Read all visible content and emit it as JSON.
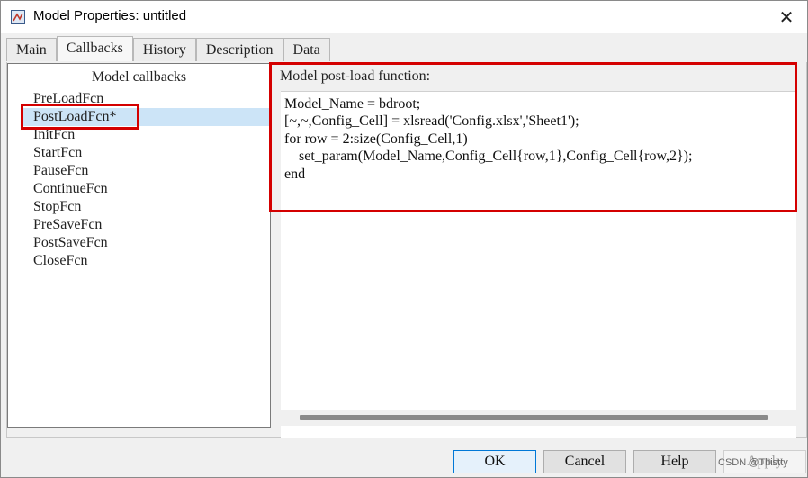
{
  "window": {
    "title": "Model Properties: untitled",
    "close_glyph": "✕"
  },
  "tabs": [
    {
      "label": "Main"
    },
    {
      "label": "Callbacks"
    },
    {
      "label": "History"
    },
    {
      "label": "Description"
    },
    {
      "label": "Data"
    }
  ],
  "active_tab": "Callbacks",
  "callbacks": {
    "header": "Model callbacks",
    "selected": "PostLoadFcn*",
    "items": [
      {
        "label": "PreLoadFcn"
      },
      {
        "label": "PostLoadFcn*"
      },
      {
        "label": "InitFcn"
      },
      {
        "label": "StartFcn"
      },
      {
        "label": "PauseFcn"
      },
      {
        "label": "ContinueFcn"
      },
      {
        "label": "StopFcn"
      },
      {
        "label": "PreSaveFcn"
      },
      {
        "label": "PostSaveFcn"
      },
      {
        "label": "CloseFcn"
      }
    ]
  },
  "editor": {
    "label": "Model post-load function:",
    "code": "Model_Name = bdroot;\n[~,~,Config_Cell] = xlsread('Config.xlsx','Sheet1');\nfor row = 2:size(Config_Cell,1)\n    set_param(Model_Name,Config_Cell{row,1},Config_Cell{row,2});\nend"
  },
  "buttons": {
    "ok": "OK",
    "cancel": "Cancel",
    "help": "Help",
    "apply": "Apply"
  },
  "watermark": "CSDN @Thistty",
  "colors": {
    "highlight_box": "#d40000",
    "selection": "#cce4f7"
  }
}
